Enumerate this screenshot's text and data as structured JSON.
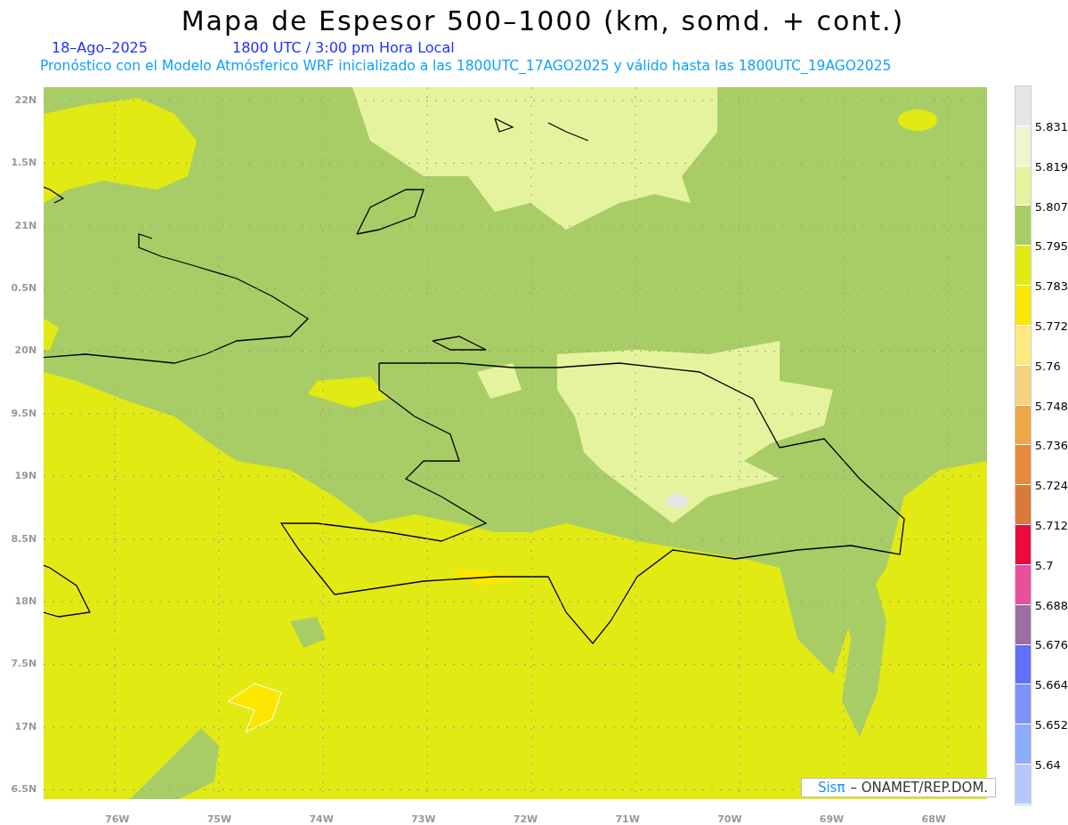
{
  "title": "Mapa de Espesor 500–1000 (km, somd. + cont.)",
  "date": "18–Ago–2025",
  "time": "1800 UTC / 3:00 pm Hora Local",
  "subtitle": "Pronóstico con el Modelo Atmósferico WRF inicializado a las 1800UTC_17AGO2025 y válido hasta las  1800UTC_19AGO2025",
  "y_axis": [
    "22N",
    "1.5N",
    "21N",
    "0.5N",
    "20N",
    "9.5N",
    "19N",
    "8.5N",
    "18N",
    "7.5N",
    "17N",
    "6.5N"
  ],
  "x_axis": [
    "76W",
    "75W",
    "74W",
    "73W",
    "72W",
    "71W",
    "70W",
    "69W",
    "68W"
  ],
  "legend": {
    "boxes": [
      {
        "color": "#e6e6e6"
      },
      {
        "color": "#eef5d0"
      },
      {
        "color": "#e6f39e"
      },
      {
        "color": "#a9cd66"
      },
      {
        "color": "#e2ea14"
      },
      {
        "color": "#fde600"
      },
      {
        "color": "#ffea80"
      },
      {
        "color": "#f5d180"
      },
      {
        "color": "#eca848"
      },
      {
        "color": "#e68a3c"
      },
      {
        "color": "#d97a3a"
      },
      {
        "color": "#ee0a3a"
      },
      {
        "color": "#e8509a"
      },
      {
        "color": "#9b6ea6"
      },
      {
        "color": "#6070f8"
      },
      {
        "color": "#8090fc"
      },
      {
        "color": "#8cacfc"
      },
      {
        "color": "#b4c8fc"
      }
    ],
    "labels": [
      "5.831",
      "5.819",
      "5.807",
      "5.795",
      "5.783",
      "5.772",
      "5.76",
      "5.748",
      "5.736",
      "5.724",
      "5.712",
      "5.7",
      "5.688",
      "5.676",
      "5.664",
      "5.652",
      "5.64"
    ]
  },
  "credit": {
    "brand": "Sisπ",
    "text": "– ONAMET/REP.DOM."
  }
}
